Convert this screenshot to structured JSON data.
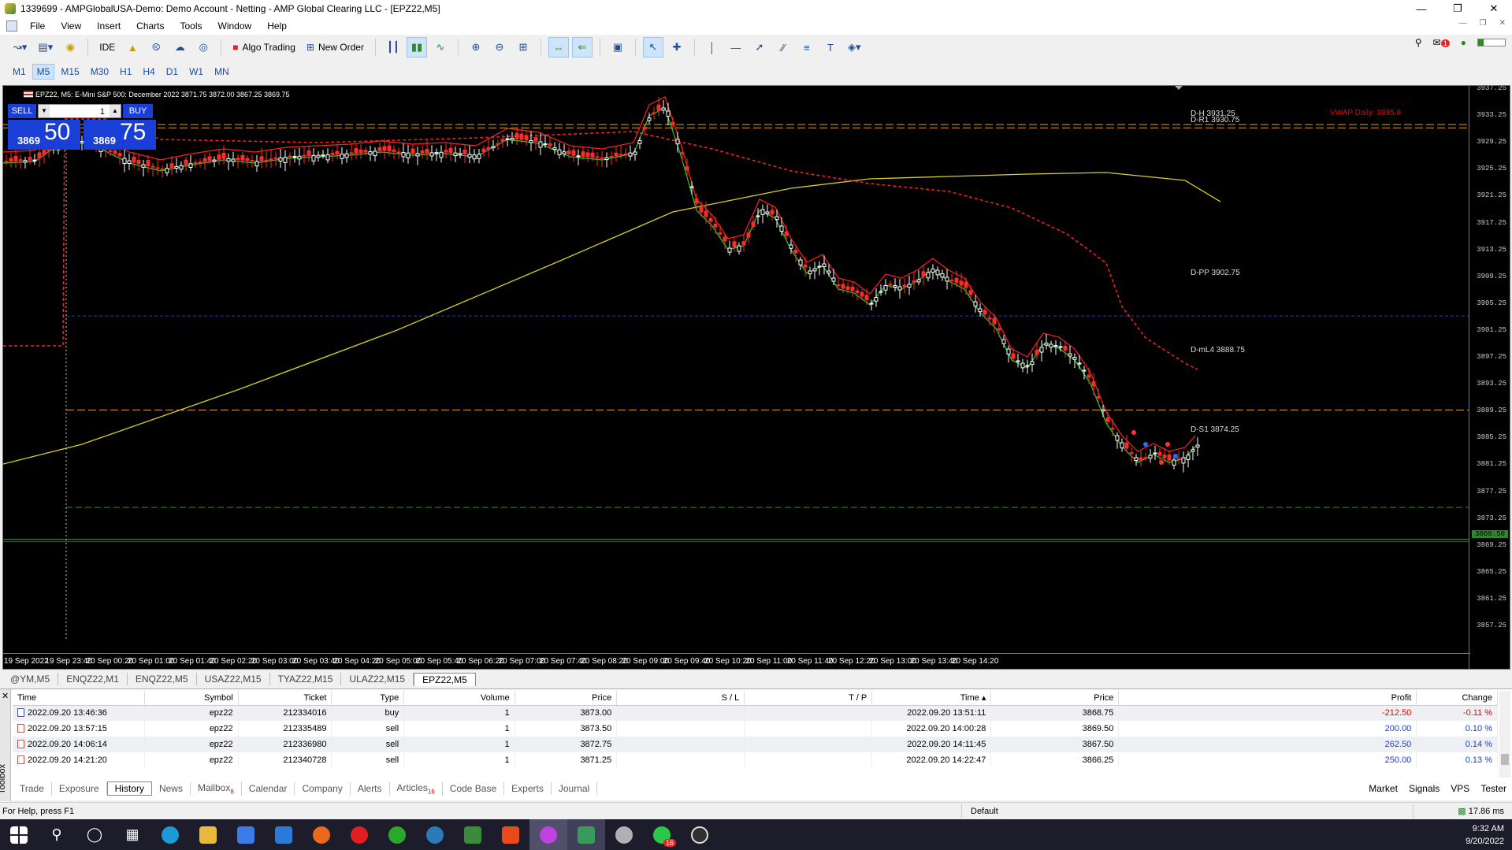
{
  "window": {
    "title": "1339699 - AMPGlobalUSA-Demo: Demo Account - Netting - AMP Global Clearing LLC - [EPZ22,M5]"
  },
  "menu": [
    "File",
    "View",
    "Insert",
    "Charts",
    "Tools",
    "Window",
    "Help"
  ],
  "toolbar": {
    "ide": "IDE",
    "algo": "Algo Trading",
    "new_order": "New Order",
    "notif_count": "1"
  },
  "timeframes": [
    "M1",
    "M5",
    "M15",
    "M30",
    "H1",
    "H4",
    "D1",
    "W1",
    "MN"
  ],
  "active_timeframe": "M5",
  "chart": {
    "info": "EPZ22, M5:  E-Mini S&P 500: December 2022  3871.75 3872.00 3867.25 3869.75",
    "one_click": {
      "sell": "SELL",
      "buy": "BUY",
      "volume": "1",
      "sell_small": "3869",
      "sell_big": "50",
      "buy_small": "3869",
      "buy_big": "75"
    },
    "price_labels": [
      "3937.25",
      "3933.25",
      "3929.25",
      "3925.25",
      "3921.25",
      "3917.25",
      "3913.25",
      "3909.25",
      "3905.25",
      "3901.25",
      "3897.25",
      "3893.25",
      "3889.25",
      "3885.25",
      "3881.25",
      "3877.25",
      "3873.25",
      "3869.25",
      "3865.25",
      "3861.25",
      "3857.25"
    ],
    "current_price": "3869.50",
    "time_labels": [
      "19 Sep 2022",
      "19 Sep 23:40",
      "20 Sep 00:20",
      "20 Sep 01:00",
      "20 Sep 01:40",
      "20 Sep 02:20",
      "20 Sep 03:00",
      "20 Sep 03:40",
      "20 Sep 04:20",
      "20 Sep 05:00",
      "20 Sep 05:40",
      "20 Sep 06:20",
      "20 Sep 07:00",
      "20 Sep 07:40",
      "20 Sep 08:20",
      "20 Sep 09:00",
      "20 Sep 09:40",
      "20 Sep 10:20",
      "20 Sep 11:00",
      "20 Sep 11:40",
      "20 Sep 12:20",
      "20 Sep 13:00",
      "20 Sep 13:40",
      "20 Sep 14:20"
    ],
    "level_labels": {
      "r1": "D-H 3931.25",
      "r1b": "D-R1 3930.75",
      "pp": "D-PP 3902.75",
      "l": "D-mL4 3888.75",
      "s1": "D-S1 3874.25",
      "vwap": "VWAP Daily: 3885.8"
    },
    "colors": {
      "candle_up": "#ffffff",
      "candle_down": "#ff2a2a",
      "ma_fast": "#ff2020",
      "ma_slow": "#20d020",
      "sma_long": "#d8d020",
      "vwap": "#ff2020",
      "pp": "#2030ff",
      "levels": "#d8a030"
    }
  },
  "symbol_tabs": [
    "@YM,M5",
    "ENQZ22,M1",
    "ENQZ22,M5",
    "USAZ22,M15",
    "TYAZ22,M15",
    "ULAZ22,M15",
    "EPZ22,M5"
  ],
  "active_symbol_tab": "EPZ22,M5",
  "history": {
    "headers": [
      "Time",
      "Symbol",
      "Ticket",
      "Type",
      "Volume",
      "Price",
      "S / L",
      "T / P",
      "Time",
      "Price",
      "Profit",
      "Change"
    ],
    "rows": [
      [
        "2022.09.20 13:46:36",
        "epz22",
        "212334016",
        "buy",
        "1",
        "3873.00",
        "",
        "",
        "2022.09.20 13:51:11",
        "3868.75",
        "-212.50",
        "-0.11 %"
      ],
      [
        "2022.09.20 13:57:15",
        "epz22",
        "212335489",
        "sell",
        "1",
        "3873.50",
        "",
        "",
        "2022.09.20 14:00:28",
        "3869.50",
        "200.00",
        "0.10 %"
      ],
      [
        "2022.09.20 14:06:14",
        "epz22",
        "212336980",
        "sell",
        "1",
        "3872.75",
        "",
        "",
        "2022.09.20 14:11:45",
        "3867.50",
        "262.50",
        "0.14 %"
      ],
      [
        "2022.09.20 14:21:20",
        "epz22",
        "212340728",
        "sell",
        "1",
        "3871.25",
        "",
        "",
        "2022.09.20 14:22:47",
        "3866.25",
        "250.00",
        "0.13 %"
      ]
    ]
  },
  "toolbox_label": "Toolbox",
  "bottom_tabs": [
    "Trade",
    "Exposure",
    "History",
    "News",
    "Mailbox",
    "Calendar",
    "Company",
    "Alerts",
    "Articles",
    "Code Base",
    "Experts",
    "Journal"
  ],
  "active_bottom_tab": "History",
  "mailbox_badge": "8",
  "articles_badge": "16",
  "bottom_right": [
    "Market",
    "Signals",
    "VPS",
    "Tester"
  ],
  "status": {
    "help": "For Help, press F1",
    "profile": "Default",
    "ping": "17.86 ms"
  },
  "clock": {
    "time": "9:32 AM",
    "date": "9/20/2022"
  },
  "taskbar_badge": "16"
}
